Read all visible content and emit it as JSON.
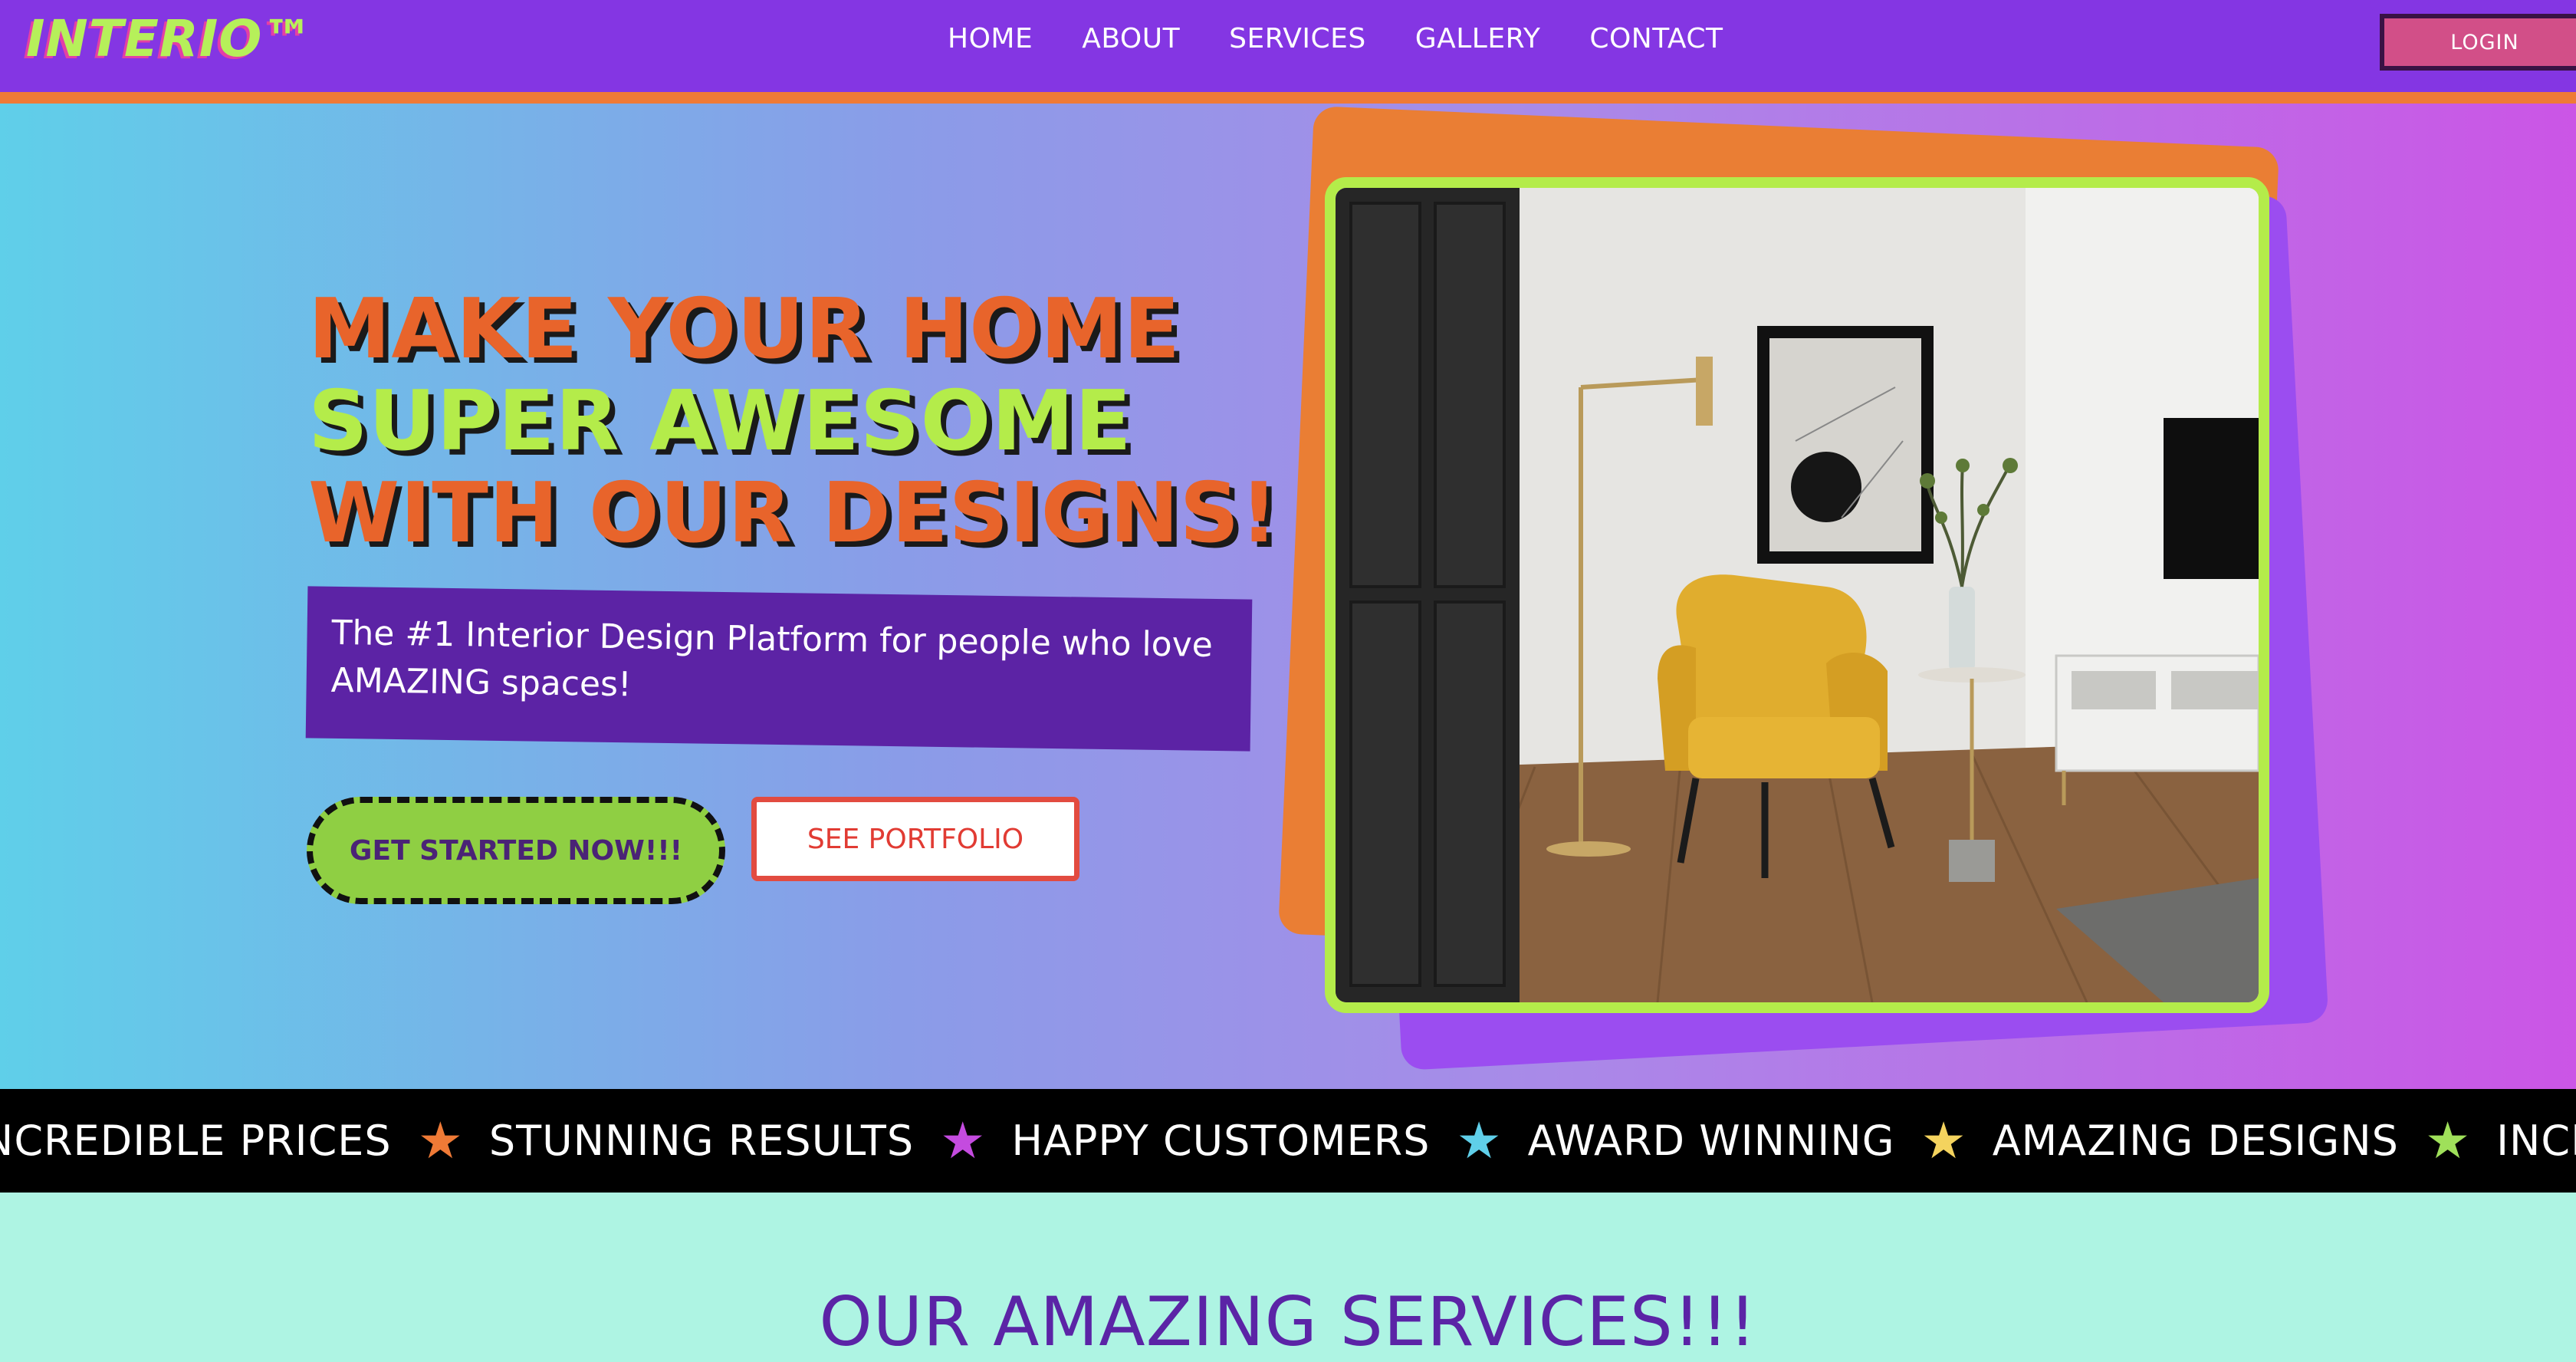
{
  "nav": {
    "logo": "INTERIO™",
    "links": [
      "HOME",
      "ABOUT",
      "SERVICES",
      "GALLERY",
      "CONTACT"
    ],
    "login_label": "LOGIN"
  },
  "hero": {
    "headline": {
      "line1": "MAKE YOUR HOME",
      "line2": "SUPER AWESOME",
      "line3": "WITH OUR DESIGNS!"
    },
    "tagline": "The #1 Interior Design Platform for people who love AMAZING spaces!",
    "cta_primary": "GET STARTED NOW!!!",
    "cta_secondary": "SEE PORTFOLIO"
  },
  "marquee": {
    "items": [
      {
        "text": "INCREDIBLE PRICES",
        "star_color": "#ef7a36"
      },
      {
        "text": "STUNNING RESULTS",
        "star_color": "#c44bdf"
      },
      {
        "text": "HAPPY CUSTOMERS",
        "star_color": "#5fcfe9"
      },
      {
        "text": "AWARD WINNING",
        "star_color": "#f4d35e"
      },
      {
        "text": "AMAZING DESIGNS",
        "star_color": "#9fe05a"
      },
      {
        "text": "INCREDIBLE PRICES",
        "star_color": ""
      }
    ],
    "star_glyph": "★"
  },
  "services": {
    "title": "OUR AMAZING SERVICES!!!"
  },
  "colors": {
    "nav_bg": "#8436e3",
    "accent_orange": "#ef7a36",
    "accent_green": "#b4ec4a",
    "login_bg": "#d24f88",
    "services_bg": "#aef4e3"
  }
}
